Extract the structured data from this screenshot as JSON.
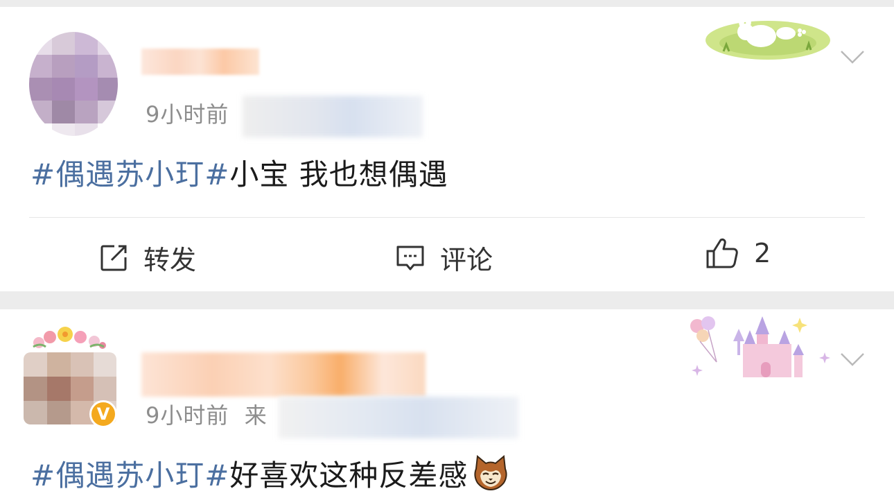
{
  "posts": [
    {
      "time": "9小时前",
      "hashtag": "#偶遇苏小玎#",
      "text": "小宝 我也想偶遇",
      "actions": {
        "repost": "转发",
        "comment": "评论",
        "like": "2"
      },
      "decoration": "bunny-on-grass-card-skin"
    },
    {
      "time": "9小时前",
      "source_prefix": "来",
      "hashtag": "#偶遇苏小玎#",
      "text": "好喜欢这种反差感",
      "emoji": "cat-face-emoji",
      "verified_badge": "V",
      "decoration": "castle-with-balloons-card-skin"
    }
  ],
  "colors": {
    "hashtag": "#4b6fa0",
    "verified": "#f4a91e",
    "background": "#ececec"
  }
}
